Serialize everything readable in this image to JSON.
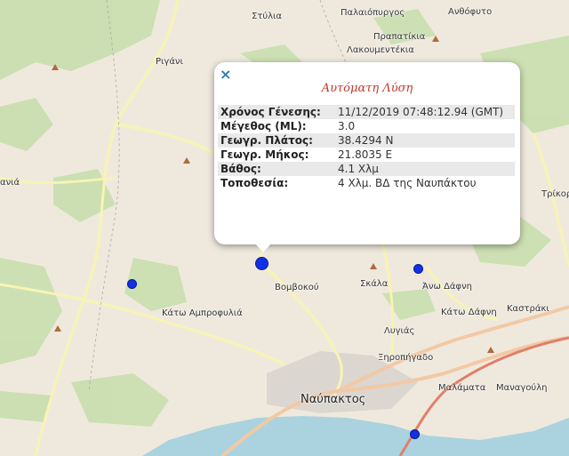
{
  "popup": {
    "close_icon": "close-x-icon",
    "title": "Αυτόματη Λύση",
    "rows": [
      {
        "key": "Χρόνος Γένεσης:",
        "value": "11/12/2019 07:48:12.94 (GMT)"
      },
      {
        "key": "Μέγεθος (ML):",
        "value": "3.0"
      },
      {
        "key": "Γεωγρ. Πλάτος:",
        "value": "38.4294 N"
      },
      {
        "key": "Γεωγρ. Μήκος:",
        "value": "21.8035 E"
      },
      {
        "key": "Βάθος:",
        "value": "4.1 Χλμ"
      },
      {
        "key": "Τοποθεσία:",
        "value": "4 Χλμ. ΒΔ της Ναυπάκτου"
      }
    ]
  },
  "places": {
    "stylia": "Στύλια",
    "palaiopyrgos": "Παλαιόπυργος",
    "anthofyto": "Ανθόφυτο",
    "prapatikia": "Πραπατίκια",
    "lakkomentekia": "Λακουμεντέκια",
    "rigani": "Ριγάνι",
    "ania": "ανιά",
    "trikorfo": "Τρίκορ",
    "vomvokou": "Βομβοκού",
    "skala": "Σκάλα",
    "ano_dafni": "Άνω Δάφνη",
    "kato_agrofylia": "Κάτω Αμπροφυλιά",
    "kato_dafni": "Κάτω Δάφνη",
    "kastraki": "Καστράκι",
    "lygias": "Λυγιάς",
    "xiropigado": "Ξηροπήγαδο",
    "malamata": "Μαλάματα",
    "managouli": "Μαναγούλη",
    "nafpaktos": "Ναύπακτος",
    "m_partial": "Μ"
  },
  "colors": {
    "land": "#efe9dd",
    "forest": "#c8dfae",
    "sea": "#aad3df",
    "urban": "#dcd6d0",
    "road_primary": "#f2c9a5",
    "road_secondary": "#f7f4b3",
    "quake_marker": "#1230e6",
    "popup_title": "#c0392b"
  },
  "markers": {
    "quake_icon": "earthquake-epicenter-dot"
  }
}
